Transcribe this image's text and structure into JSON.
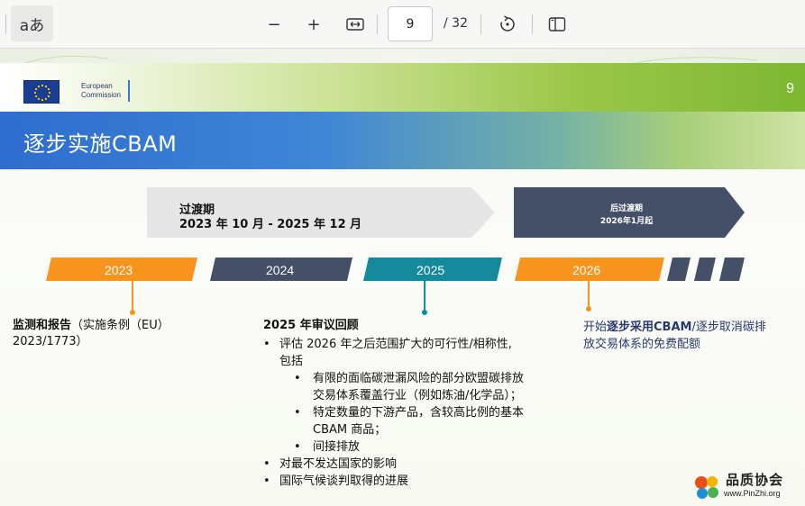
{
  "toolbar": {
    "read_aloud_glyph": "aあ",
    "zoom_out_glyph": "−",
    "zoom_in_glyph": "+",
    "fit_glyph": "⟷",
    "current_page": "9",
    "total_pages": "/ 32"
  },
  "slide": {
    "number": "9",
    "logo_line1": "European",
    "logo_line2": "Commission",
    "title": "逐步实施CBAM",
    "transition": {
      "label": "过渡期",
      "period": "2023 年 10 月 - 2025 年 12 月"
    },
    "post_transition": {
      "label": "后过渡期",
      "date": "2026年1月起"
    },
    "years": [
      "2023",
      "2024",
      "2025",
      "2026"
    ],
    "left_block": {
      "bold": "监测和报告",
      "rest": "（实施条例（EU）",
      "line2": "2023/1773）"
    },
    "middle_block": {
      "heading": "2025 年审议回顾",
      "item1_line1": "评估 2026 年之后范围扩大的可行性/相称性,",
      "item1_line2": "包括",
      "sub1_line1": "有限的面临碳泄漏风险的部分欧盟碳排放",
      "sub1_line2": "交易体系覆盖行业（例如炼油/化学品）；",
      "sub2_line1": " 特定数量的下游产品，含较高比例的基本",
      "sub2_line2": "CBAM 商品；",
      "sub3": "间接排放",
      "item2": "对最不发达国家的影响",
      "item3": "国际气候谈判取得的进展"
    },
    "right_block": {
      "pre": "开始",
      "bold": "逐步采用CBAM",
      "post": "/逐步取消碳排",
      "line2": "放交易体系的免费配额"
    }
  },
  "watermark": {
    "name": "品质协会",
    "url": "www.PinZhi.org"
  },
  "colors": {
    "orange": "#f7941d",
    "navy": "#445068",
    "teal": "#158a9c",
    "light_arrow": "#e5e5e5"
  }
}
